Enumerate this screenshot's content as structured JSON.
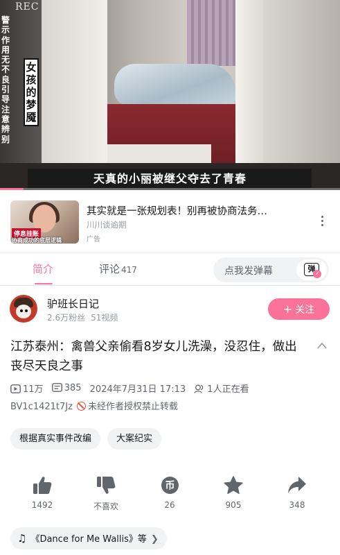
{
  "player": {
    "rec_label": "REC",
    "side_warning": [
      "警",
      "示",
      "作",
      "用",
      "无",
      "不",
      "良",
      "引",
      "导",
      "注",
      "意",
      "辨",
      "别"
    ],
    "title_box": [
      "女",
      "孩",
      "的",
      "梦",
      "魇"
    ],
    "subtitle": "天真的小丽被继父夺去了青春",
    "progress": 0.07
  },
  "ad": {
    "thumb_tag_1": "停息挂账",
    "thumb_tag_2": "协商成功的底层逻辑",
    "title": "其实就是一张规划表！别再被协商法务…",
    "source": "川川谈逾期",
    "label": "广告"
  },
  "tabs": {
    "intro": "简介",
    "comments": "评论",
    "comments_count": "417",
    "danmaku_placeholder": "点我发弹幕",
    "danmaku_icon_char": "弹"
  },
  "uploader": {
    "name": "驴班长日记",
    "fans": "2.6万粉丝",
    "videos": "51视频",
    "follow_label": "关注"
  },
  "video": {
    "title": "江苏泰州：禽兽父亲偷看8岁女儿洗澡，没忍住，做出丧尽天良之事",
    "views": "11万",
    "danmaku_count": "385",
    "publish_time": "2024年7月31日 17:13",
    "watching": "1人正在看",
    "bvid": "BV1c1421t7Jz",
    "repost_notice": "未经作者授权禁止转载"
  },
  "tags": [
    "根据真实事件改编",
    "大案纪实"
  ],
  "actions": {
    "like": "1492",
    "dislike": "不喜欢",
    "coin": "26",
    "coin_icon_char": "币",
    "favorite": "905",
    "share": "348"
  },
  "music": {
    "text": "《Dance for Me Wallis》",
    "suffix": "等"
  },
  "colors": {
    "accent": "#fb7299",
    "text_primary": "#18191c",
    "text_secondary": "#61666d",
    "text_tertiary": "#9499a0",
    "chip_bg": "#f1f2f3",
    "warning": "#e2553d"
  }
}
